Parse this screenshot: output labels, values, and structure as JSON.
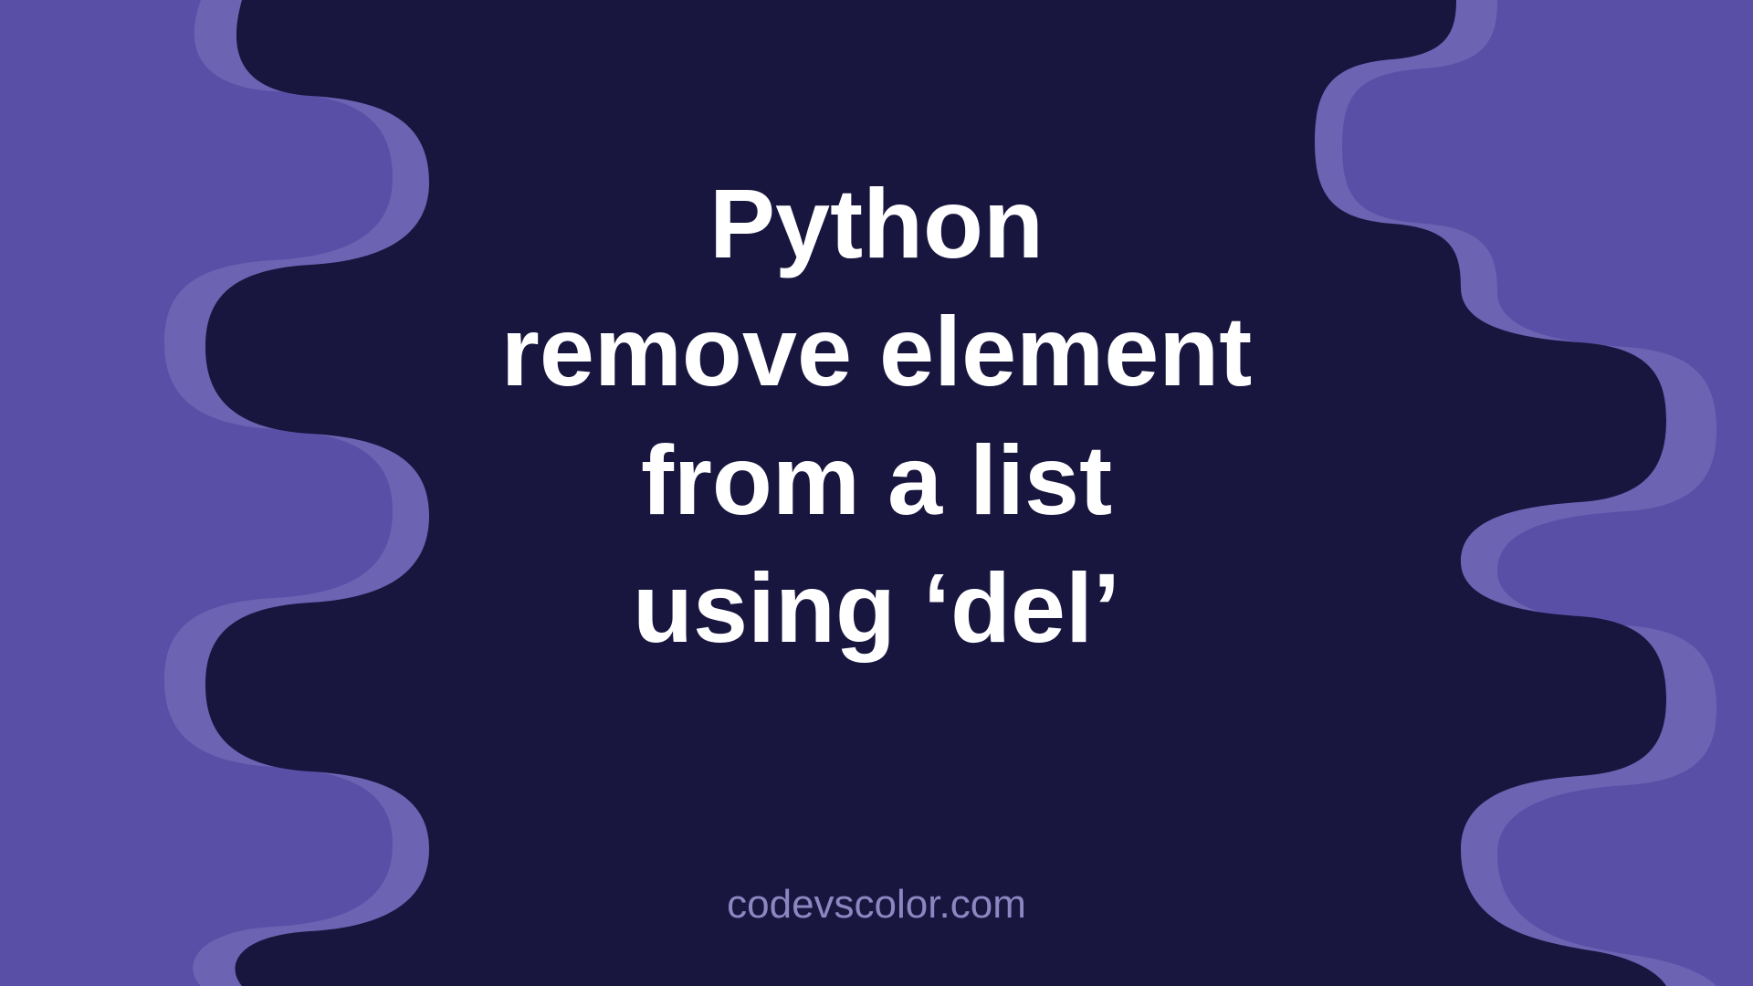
{
  "title": {
    "line1": "Python",
    "line2": "remove element",
    "line3": "from a list",
    "line4": "using ‘del’"
  },
  "attribution": "codevscolor.com",
  "colors": {
    "background_outer": "#5a4fa6",
    "background_inner": "#18163f",
    "blob_mid": "#6d63b3",
    "text_primary": "#ffffff",
    "text_secondary": "#8d86c1"
  }
}
